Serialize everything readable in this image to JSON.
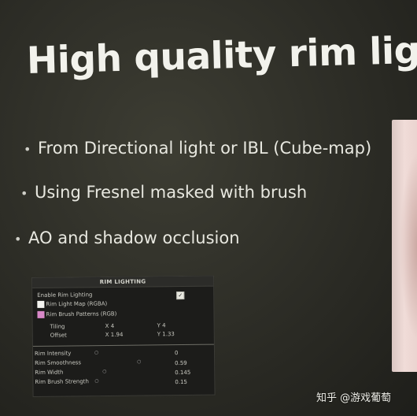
{
  "slide": {
    "title": "High quality rim light",
    "bullets": [
      "From Directional light or IBL (Cube-map)",
      "Using Fresnel masked with brush",
      "AO and shadow occlusion"
    ]
  },
  "panel": {
    "header": "RIM LIGHTING",
    "enable_label": "Enable Rim Lighting",
    "enable_checked": "✓",
    "light_map_label": "Rim Light Map (RGBA)",
    "brush_patterns_label": "Rim Brush Patterns (RGB)",
    "tiling_label": "Tiling",
    "tiling_x": "X 4",
    "tiling_y": "Y 4",
    "offset_label": "Offset",
    "offset_x": "X 1.94",
    "offset_y": "Y 1.33",
    "sliders": [
      {
        "label": "Rim Intensity",
        "value": "0"
      },
      {
        "label": "Rim Smoothness",
        "value": "0.59"
      },
      {
        "label": "Rim Width",
        "value": "0.145"
      },
      {
        "label": "Rim Brush Strength",
        "value": "0.15"
      }
    ]
  },
  "watermark": "知乎 @游戏葡萄"
}
